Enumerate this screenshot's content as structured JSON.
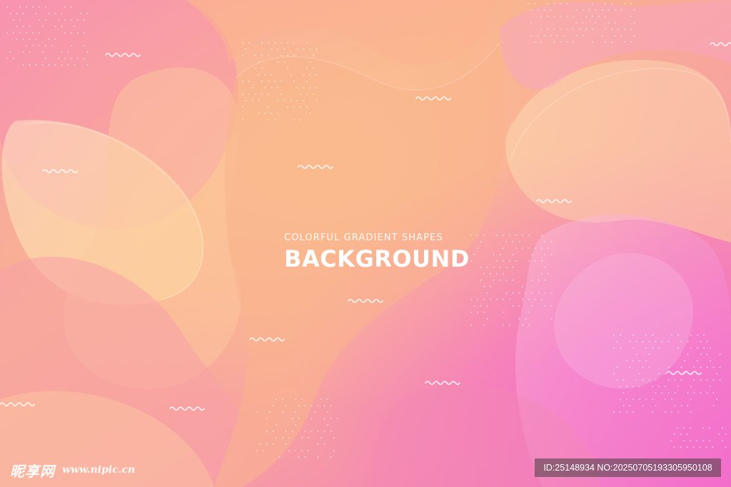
{
  "poster": {
    "subtitle": "COLORFUL GRADIENT SHAPES",
    "title": "BACKGROUND"
  },
  "watermark": {
    "logo_text": "昵享网",
    "url": "www.nipic.cn",
    "id_text": "ID:25148934 NO:20250705193305950108"
  },
  "colors": {
    "peach": "#f9b98a",
    "pink": "#f77ba3",
    "magenta": "#f268c8",
    "cream": "#fde0b0",
    "white": "#ffffff"
  }
}
